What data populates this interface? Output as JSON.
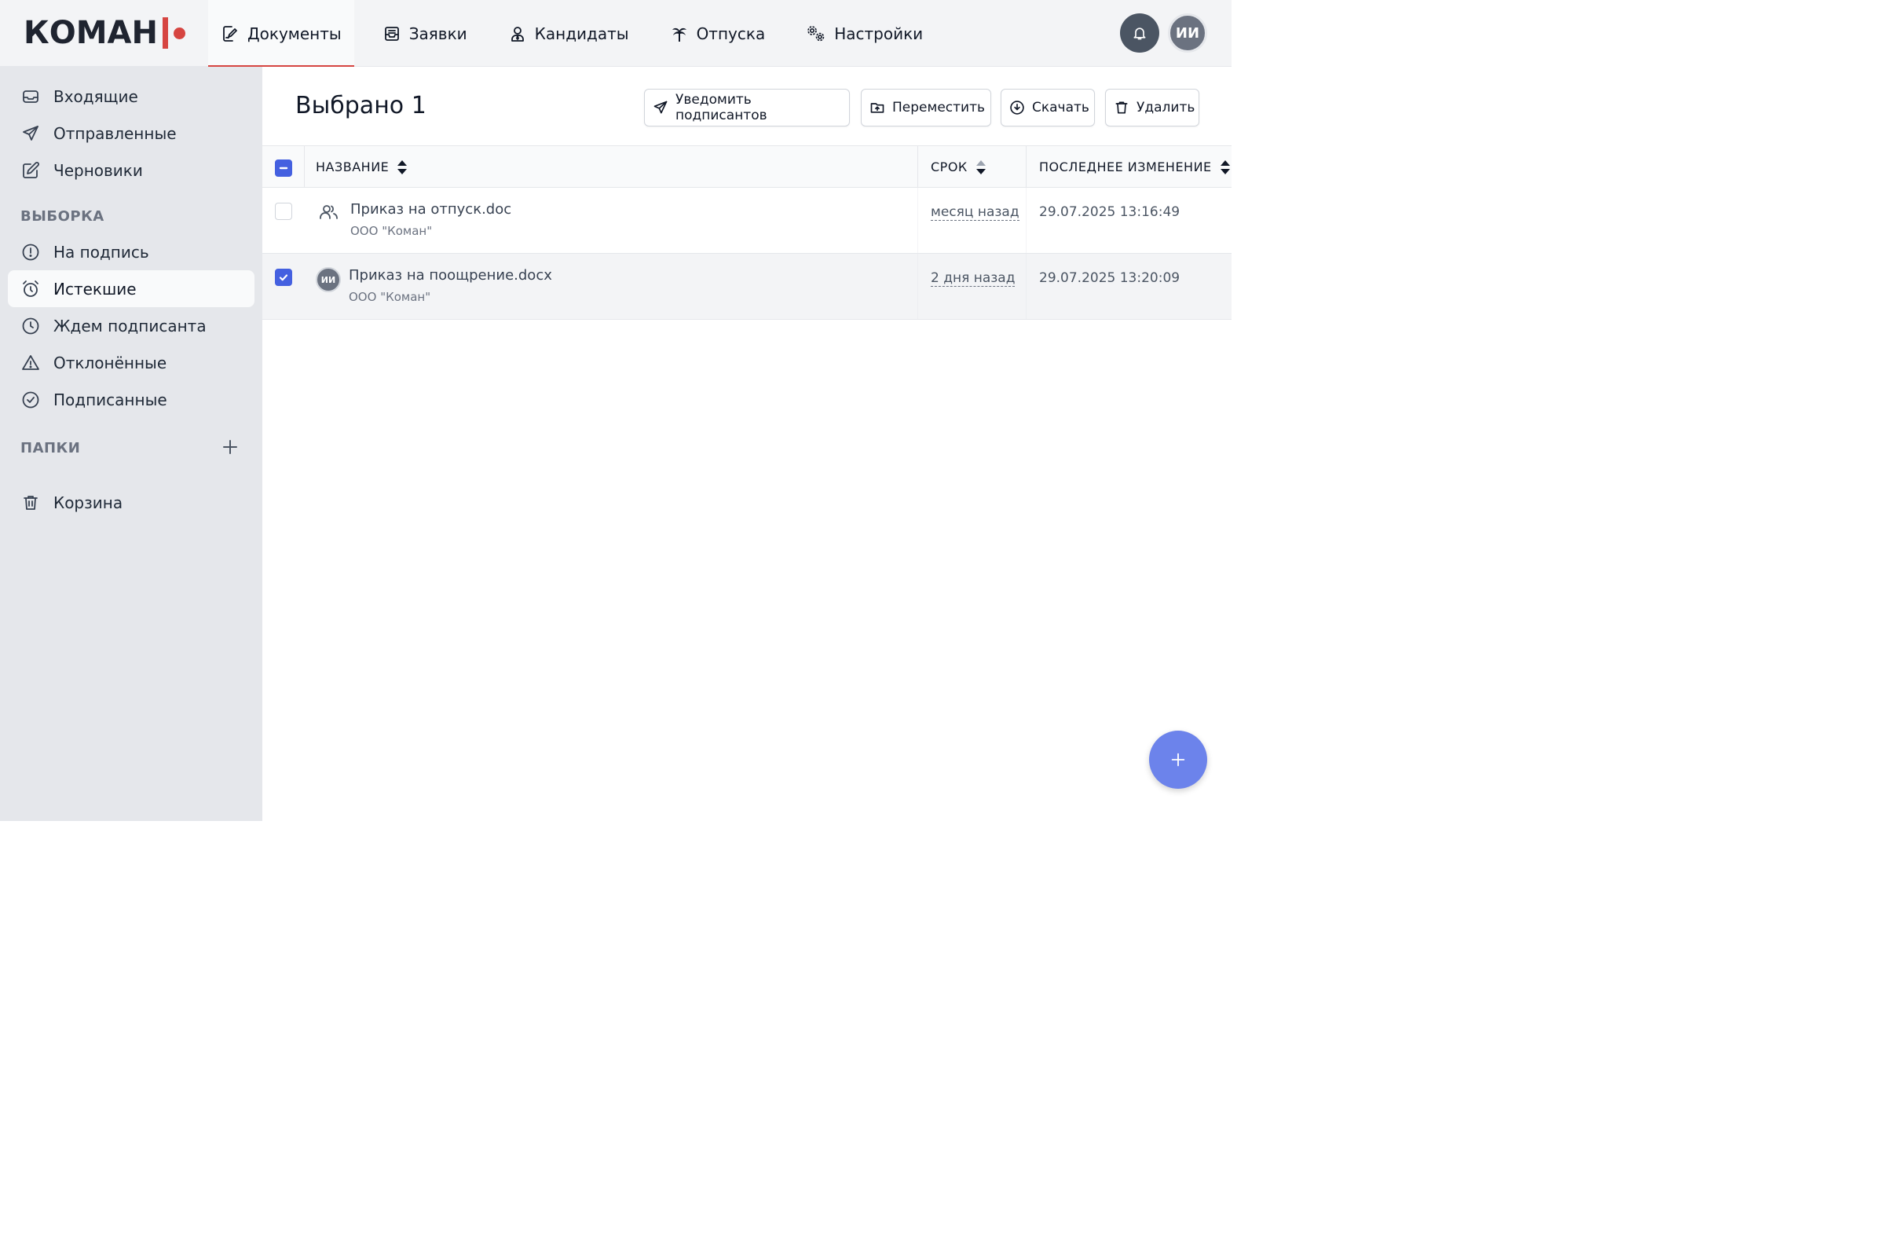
{
  "brand": {
    "logo_text": "КОМАН",
    "accent_color": "#d64541"
  },
  "nav": {
    "items": [
      {
        "label": "Документы",
        "icon": "document-sign-icon",
        "active": true
      },
      {
        "label": "Заявки",
        "icon": "inbox-tray-icon"
      },
      {
        "label": "Кандидаты",
        "icon": "person-icon"
      },
      {
        "label": "Отпуска",
        "icon": "palm-tree-icon"
      },
      {
        "label": "Настройки",
        "icon": "gears-icon"
      }
    ],
    "user_initials": "ИИ"
  },
  "sidebar": {
    "main_items": [
      {
        "label": "Входящие",
        "icon": "inbox-icon"
      },
      {
        "label": "Отправленные",
        "icon": "send-icon"
      },
      {
        "label": "Черновики",
        "icon": "edit-icon"
      }
    ],
    "selection_title": "ВЫБОРКА",
    "selection_items": [
      {
        "label": "На подпись",
        "icon": "exclamation-circle-icon"
      },
      {
        "label": "Истекшие",
        "icon": "alarm-clock-icon",
        "active": true
      },
      {
        "label": "Ждем подписанта",
        "icon": "clock-icon"
      },
      {
        "label": "Отклонённые",
        "icon": "warning-triangle-icon"
      },
      {
        "label": "Подписанные",
        "icon": "check-circle-icon"
      }
    ],
    "folders_title": "ПАПКИ",
    "trash_label": "Корзина"
  },
  "main": {
    "title": "Выбрано 1",
    "actions": {
      "notify": "Уведомить подписантов",
      "move": "Переместить",
      "download": "Скачать",
      "delete": "Удалить"
    },
    "table": {
      "headers": {
        "name": "НАЗВАНИЕ",
        "deadline": "СРОК",
        "modified": "ПОСЛЕДНЕЕ ИЗМЕНЕНИЕ"
      },
      "rows": [
        {
          "name": "Приказ на отпуск.doc",
          "org": "ООО \"Коман\"",
          "deadline": "месяц назад",
          "modified": "29.07.2025 13:16:49",
          "selected": false,
          "icon": "users-icon"
        },
        {
          "name": "Приказ на поощрение.docx",
          "org": "ООО \"Коман\"",
          "deadline": "2 дня назад",
          "modified": "29.07.2025 13:20:09",
          "selected": true,
          "avatar": "ИИ"
        }
      ]
    }
  },
  "colors": {
    "primary": "#4460e0",
    "fab": "#6c83eb",
    "sidebar_bg": "#e5e7eb"
  }
}
